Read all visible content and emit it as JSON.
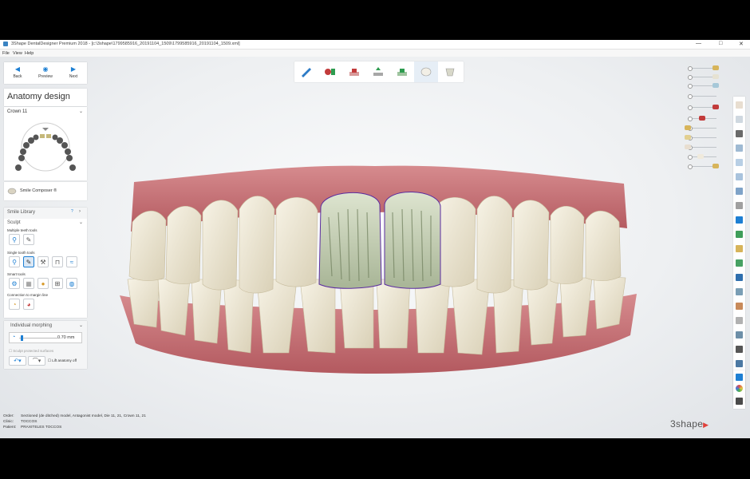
{
  "window": {
    "title": "3Shape DentalDesigner Premium 2018 - [c:\\3shape\\1799585916_20191104_1509\\1799585916_20191104_1509.xml]",
    "controls": [
      "—",
      "□",
      "✕"
    ]
  },
  "menu": [
    "File",
    "View",
    "Help"
  ],
  "nav": {
    "back": "Back",
    "preview": "Preview",
    "next": "Next"
  },
  "panel": {
    "title": "Anatomy design",
    "crown_select": "Crown 11",
    "smile_composer": "Smile Composer ®",
    "library_title": "Smile Library",
    "library_badge": "?",
    "sculpt": "Sculpt",
    "multiple_tools": "Multiple teeth tools",
    "single_tools": "Single tooth tools",
    "smart_tools": "Smart tools",
    "connection": "Connection to margin line",
    "morphing_title": "Individual morphing",
    "morph_value": "0.70 mm",
    "sculpt_protected": "Sculpt protected surfaces",
    "lift_anatomy": "Lift anatomy off"
  },
  "order_info": [
    {
      "key": "Order:",
      "value": "Sectioned (de ditched) model, Antagonist model, Die 11, 21, Crown 11, 21"
    },
    {
      "key": "Clinic:",
      "value": "TOCCOS"
    },
    {
      "key": "Patient:",
      "value": "PRAXITELES TOCCOS"
    }
  ],
  "logo": {
    "text": "3shape",
    "mark": "▶"
  },
  "colors": {
    "accent": "#1d7fd3",
    "gum": "#c9737a",
    "tooth": "#ede8d8",
    "crown": "#c7d2b8",
    "logo_mark": "#e0413b"
  }
}
